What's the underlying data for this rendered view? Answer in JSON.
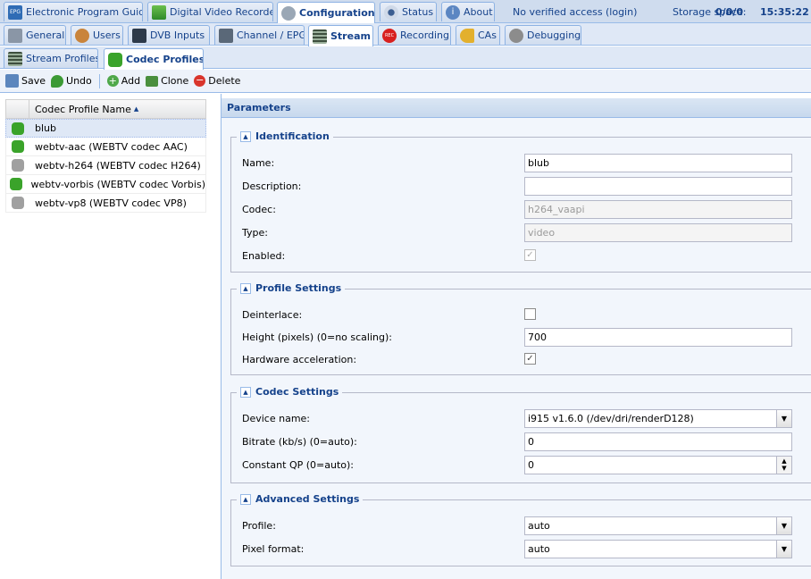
{
  "top_tabs": [
    {
      "label": "Electronic Program Guide",
      "icon": "epg-icon"
    },
    {
      "label": "Digital Video Recorder",
      "icon": "download-icon"
    },
    {
      "label": "Configuration",
      "icon": "wrench-icon"
    },
    {
      "label": "Status",
      "icon": "eye-icon"
    },
    {
      "label": "About",
      "icon": "info-icon"
    }
  ],
  "top_info": {
    "access": "No verified access",
    "login": "(login)",
    "storage_label": "Storage space:",
    "storage_value": "0/0/0",
    "time": "15:35:22"
  },
  "config_tabs": [
    {
      "label": "General",
      "icon": "tools-icon"
    },
    {
      "label": "Users",
      "icon": "users-icon"
    },
    {
      "label": "DVB Inputs",
      "icon": "tv-card-icon"
    },
    {
      "label": "Channel / EPG",
      "icon": "tv-icon"
    },
    {
      "label": "Stream",
      "icon": "film-icon"
    },
    {
      "label": "Recording",
      "icon": "rec-icon"
    },
    {
      "label": "CAs",
      "icon": "key-icon"
    },
    {
      "label": "Debugging",
      "icon": "bug-icon"
    }
  ],
  "stream_tabs": [
    {
      "label": "Stream Profiles",
      "icon": "film-icon"
    },
    {
      "label": "Codec Profiles",
      "icon": "puzzle-icon"
    }
  ],
  "toolbar": {
    "save": "Save",
    "undo": "Undo",
    "add": "Add",
    "clone": "Clone",
    "delete": "Delete"
  },
  "grid": {
    "column": "Codec Profile Name",
    "rows": [
      {
        "name": "blub",
        "enabled": true
      },
      {
        "name": "webtv-aac (WEBTV codec AAC)",
        "enabled": true
      },
      {
        "name": "webtv-h264 (WEBTV codec H264)",
        "enabled": false
      },
      {
        "name": "webtv-vorbis (WEBTV codec Vorbis)",
        "enabled": true
      },
      {
        "name": "webtv-vp8 (WEBTV codec VP8)",
        "enabled": false
      }
    ]
  },
  "params": {
    "title": "Parameters",
    "identification": {
      "legend": "Identification",
      "name_label": "Name:",
      "name_value": "blub",
      "desc_label": "Description:",
      "desc_value": "",
      "codec_label": "Codec:",
      "codec_value": "h264_vaapi",
      "type_label": "Type:",
      "type_value": "video",
      "enabled_label": "Enabled:"
    },
    "profile": {
      "legend": "Profile Settings",
      "deint_label": "Deinterlace:",
      "height_label": "Height (pixels) (0=no scaling):",
      "height_value": "700",
      "hw_label": "Hardware acceleration:"
    },
    "codec": {
      "legend": "Codec Settings",
      "device_label": "Device name:",
      "device_value": "i915 v1.6.0 (/dev/dri/renderD128)",
      "bitrate_label": "Bitrate (kb/s) (0=auto):",
      "bitrate_value": "0",
      "qp_label": "Constant QP (0=auto):",
      "qp_value": "0"
    },
    "advanced": {
      "legend": "Advanced Settings",
      "profile_label": "Profile:",
      "profile_value": "auto",
      "pixfmt_label": "Pixel format:",
      "pixfmt_value": "auto"
    }
  },
  "colors": {
    "accent": "#15428b",
    "border": "#99bbe8",
    "enabled_puzzle": "#3aa32a",
    "disabled_puzzle": "#a0a0a0"
  }
}
